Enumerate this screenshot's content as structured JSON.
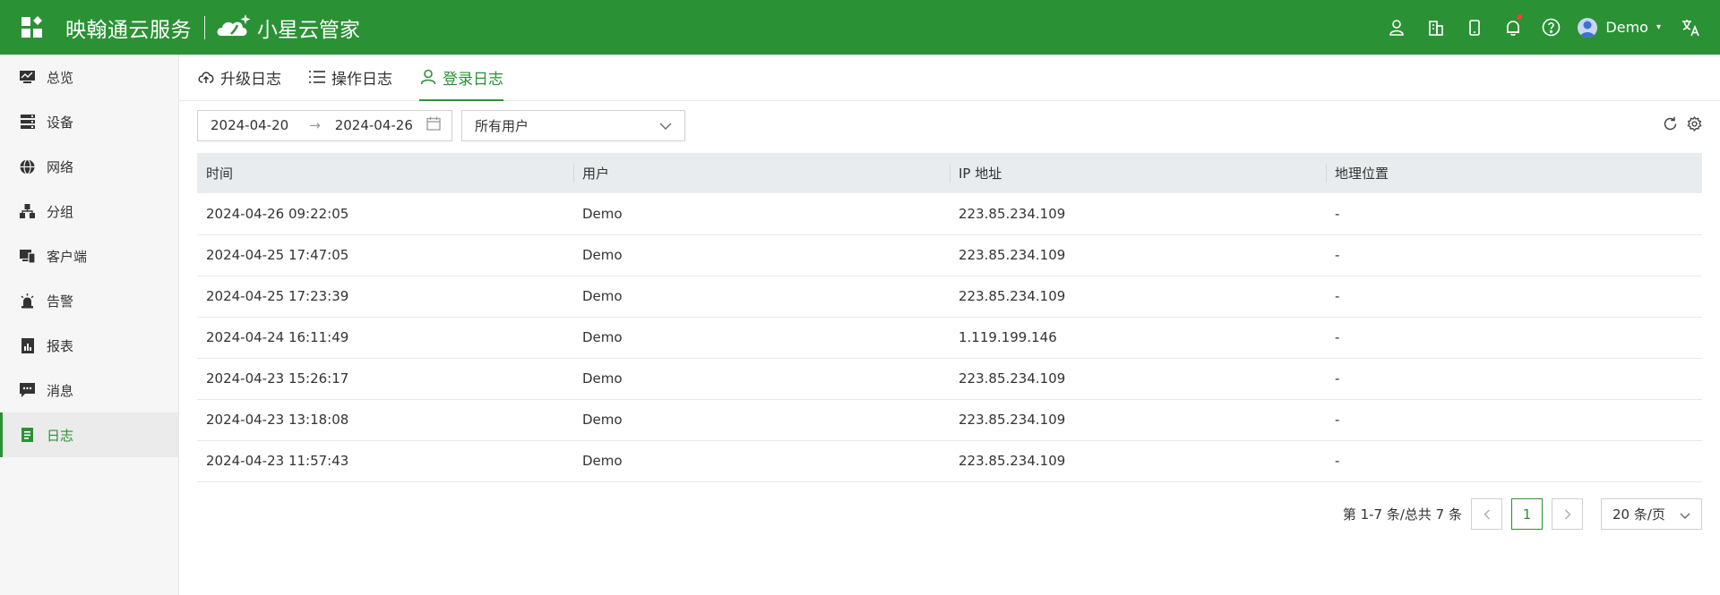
{
  "header": {
    "brand": "映翰通云服务",
    "product": "小星云管家",
    "user": "Demo",
    "icons": [
      "apps-icon",
      "user-group-icon",
      "building-icon",
      "mobile-icon",
      "bell-icon",
      "help-icon",
      "avatar",
      "translate-icon"
    ]
  },
  "sidebar": {
    "items": [
      {
        "label": "总览",
        "icon": "dashboard-icon"
      },
      {
        "label": "设备",
        "icon": "server-icon"
      },
      {
        "label": "网络",
        "icon": "globe-icon"
      },
      {
        "label": "分组",
        "icon": "cluster-icon"
      },
      {
        "label": "客户端",
        "icon": "devices-icon"
      },
      {
        "label": "告警",
        "icon": "alarm-icon"
      },
      {
        "label": "报表",
        "icon": "report-icon"
      },
      {
        "label": "消息",
        "icon": "message-icon"
      },
      {
        "label": "日志",
        "icon": "log-icon",
        "active": true
      }
    ]
  },
  "tabs": [
    {
      "label": "升级日志",
      "icon": "cloud-upload-icon"
    },
    {
      "label": "操作日志",
      "icon": "list-icon"
    },
    {
      "label": "登录日志",
      "icon": "user-icon",
      "active": true
    }
  ],
  "filters": {
    "start_date": "2024-04-20",
    "end_date": "2024-04-26",
    "user_select": "所有用户"
  },
  "table": {
    "columns": [
      "时间",
      "用户",
      "IP 地址",
      "地理位置"
    ],
    "rows": [
      [
        "2024-04-26 09:22:05",
        "Demo",
        "223.85.234.109",
        "-"
      ],
      [
        "2024-04-25 17:47:05",
        "Demo",
        "223.85.234.109",
        "-"
      ],
      [
        "2024-04-25 17:23:39",
        "Demo",
        "223.85.234.109",
        "-"
      ],
      [
        "2024-04-24 16:11:49",
        "Demo",
        "1.119.199.146",
        "-"
      ],
      [
        "2024-04-23 15:26:17",
        "Demo",
        "223.85.234.109",
        "-"
      ],
      [
        "2024-04-23 13:18:08",
        "Demo",
        "223.85.234.109",
        "-"
      ],
      [
        "2024-04-23 11:57:43",
        "Demo",
        "223.85.234.109",
        "-"
      ]
    ]
  },
  "pagination": {
    "summary": "第 1-7 条/总共 7 条",
    "current_page": "1",
    "page_size": "20 条/页"
  },
  "colors": {
    "brand_green": "#2b9135",
    "header_bg": "#2b9135",
    "notify_dot": "#ff3b30"
  }
}
